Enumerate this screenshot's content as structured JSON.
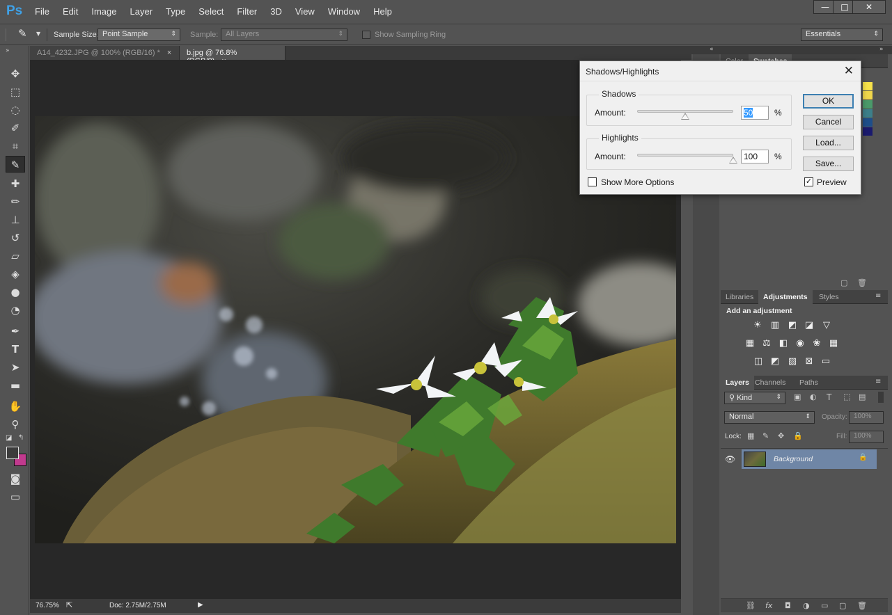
{
  "app": {
    "logo": "Ps",
    "menu": [
      "File",
      "Edit",
      "Image",
      "Layer",
      "Type",
      "Select",
      "Filter",
      "3D",
      "View",
      "Window",
      "Help"
    ],
    "window_controls": [
      "—",
      "□",
      "✕"
    ]
  },
  "options_bar": {
    "sample_size_label": "Sample Size:",
    "sample_size_value": "Point Sample",
    "sample_label": "Sample:",
    "sample_value": "All Layers",
    "show_ring_label": "Show Sampling Ring",
    "workspace": "Essentials"
  },
  "tabs": [
    {
      "label": "A14_4232.JPG @ 100% (RGB/16) *",
      "close": "×"
    },
    {
      "label": "b.jpg @ 76.8% (RGB/8)",
      "close": "×"
    }
  ],
  "status": {
    "zoom": "76.75%",
    "doc": "Doc: 2.75M/2.75M"
  },
  "top_panel": {
    "tabs": [
      "Color",
      "Swatches"
    ],
    "swatches": [
      "#f7e24a",
      "#f0d64b",
      "#4a9a6a",
      "#3c7f8a",
      "#1e4e8a",
      "#1a1a6e"
    ]
  },
  "adjustments_panel": {
    "tabs": [
      "Libraries",
      "Adjustments",
      "Styles"
    ],
    "heading": "Add an adjustment",
    "row1": [
      "☀",
      "▥",
      "◩",
      "◪",
      "▽"
    ],
    "row2": [
      "▦",
      "⚖",
      "◧",
      "◉",
      "❀",
      "▦"
    ],
    "row3": [
      "◫",
      "◩",
      "▨",
      "⊠",
      "▭"
    ]
  },
  "layers_panel": {
    "tabs": [
      "Layers",
      "Channels",
      "Paths"
    ],
    "kind_label": "Kind",
    "blend_mode": "Normal",
    "opacity_label": "Opacity:",
    "opacity_value": "100%",
    "lock_label": "Lock:",
    "fill_label": "Fill:",
    "fill_value": "100%",
    "layer_name": "Background",
    "footer_icons": [
      "⛓",
      "fx",
      "◘",
      "◑",
      "▭",
      "▢",
      "🗑"
    ]
  },
  "dialog": {
    "title": "Shadows/Highlights",
    "shadows": {
      "label": "Shadows",
      "amount_label": "Amount:",
      "amount_value": "50",
      "amount": 50,
      "unit": "%"
    },
    "highlights": {
      "label": "Highlights",
      "amount_label": "Amount:",
      "amount_value": "100",
      "amount": 100,
      "unit": "%"
    },
    "show_more_options": "Show More Options",
    "preview_label": "Preview",
    "preview_checked": true,
    "buttons": {
      "ok": "OK",
      "cancel": "Cancel",
      "load": "Load...",
      "save": "Save..."
    }
  }
}
